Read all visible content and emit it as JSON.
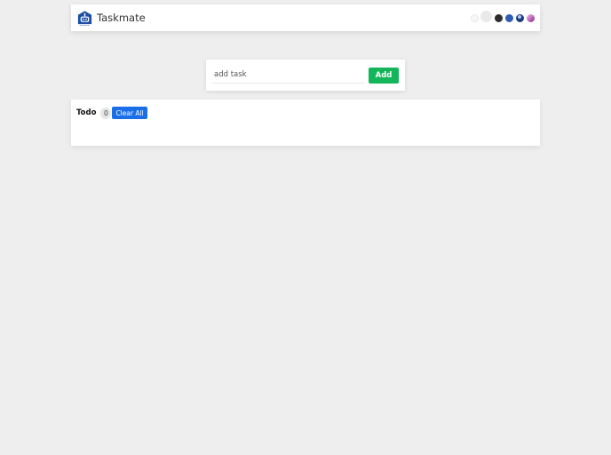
{
  "header": {
    "app_title": "Taskmate",
    "logo_icon": "robot-house-icon",
    "theme_options": [
      "light",
      "grey",
      "dark",
      "blue",
      "navy",
      "pink"
    ]
  },
  "add_task": {
    "placeholder": "add task",
    "value": "",
    "add_label": "Add"
  },
  "todo": {
    "label": "Todo",
    "count": "0",
    "clear_label": "Clear All"
  },
  "colors": {
    "background": "#eeeeee",
    "add_button": "#13b75a",
    "clear_button": "#1a6fe8",
    "logo": "#1f4fa3"
  }
}
